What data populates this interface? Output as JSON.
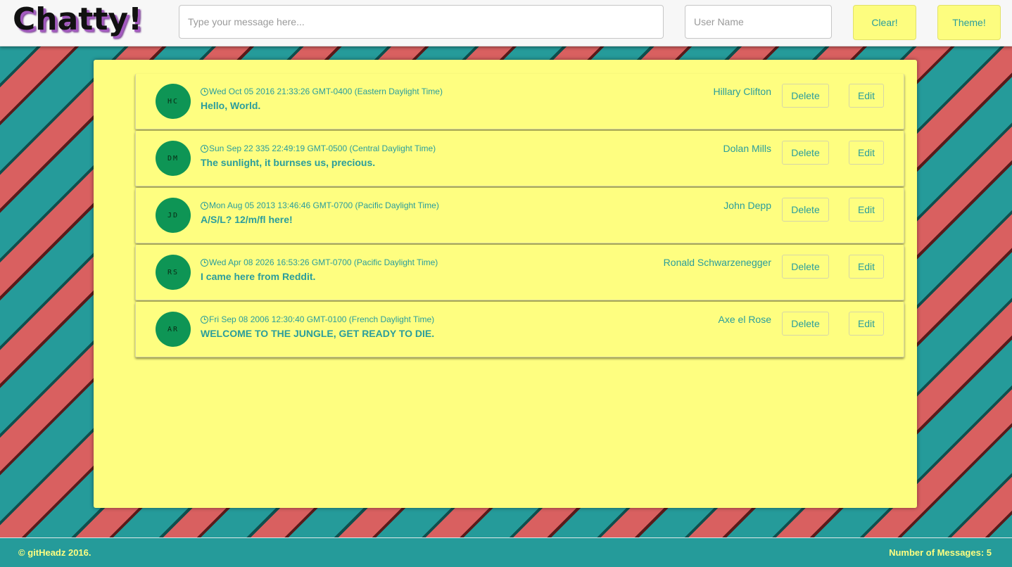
{
  "header": {
    "logo": "Chatty!",
    "message_placeholder": "Type your message here...",
    "username_placeholder": "User Name",
    "clear_label": "Clear!",
    "theme_label": "Theme!"
  },
  "messages": [
    {
      "initials": "HC",
      "timestamp": "Wed Oct 05 2016 21:33:26 GMT-0400 (Eastern Daylight Time)",
      "text": "Hello, World.",
      "author": "Hillary Clifton",
      "delete_label": "Delete",
      "edit_label": "Edit"
    },
    {
      "initials": "DM",
      "timestamp": "Sun Sep 22 335 22:49:19 GMT-0500 (Central Daylight Time)",
      "text": "The sunlight, it burnses us, precious.",
      "author": "Dolan Mills",
      "delete_label": "Delete",
      "edit_label": "Edit"
    },
    {
      "initials": "JD",
      "timestamp": "Mon Aug 05 2013 13:46:46 GMT-0700 (Pacific Daylight Time)",
      "text": "A/S/L? 12/m/fl here!",
      "author": "John Depp",
      "delete_label": "Delete",
      "edit_label": "Edit"
    },
    {
      "initials": "RS",
      "timestamp": "Wed Apr 08 2026 16:53:26 GMT-0700 (Pacific Daylight Time)",
      "text": "I came here from Reddit.",
      "author": "Ronald Schwarzenegger",
      "delete_label": "Delete",
      "edit_label": "Edit"
    },
    {
      "initials": "AR",
      "timestamp": "Fri Sep 08 2006 12:30:40 GMT-0100 (French Daylight Time)",
      "text": "WELCOME TO THE JUNGLE, GET READY TO DIE.",
      "author": "Axe el Rose",
      "delete_label": "Delete",
      "edit_label": "Edit"
    }
  ],
  "footer": {
    "copyright": "© gitHeadz 2016.",
    "message_count": "Number of Messages: 5"
  },
  "colors": {
    "accent": "#2a9d9c",
    "panel": "#fefe80",
    "avatar": "#0e9555",
    "stripe_red": "#d96060"
  }
}
